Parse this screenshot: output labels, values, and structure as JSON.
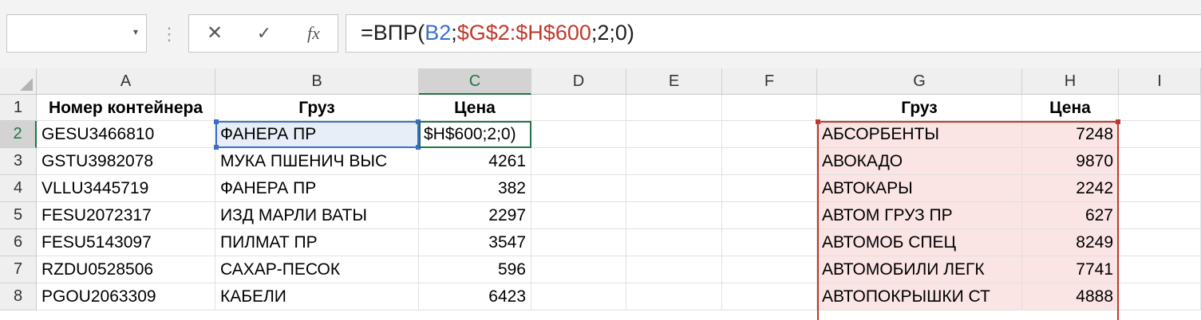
{
  "formula_bar": {
    "name_box_value": "",
    "cancel_icon": "x-mark",
    "enter_icon": "check-mark",
    "fx_label": "fx",
    "formula_parts": {
      "p1": "=ВПР(",
      "p2": "B2",
      "p3": ";",
      "p4": "$G$2:$H$600",
      "p5": ";2;0)"
    }
  },
  "columns": [
    "A",
    "B",
    "C",
    "D",
    "E",
    "F",
    "G",
    "H",
    "I"
  ],
  "rows": [
    "1",
    "2",
    "3",
    "4",
    "5",
    "6",
    "7",
    "8"
  ],
  "table1": {
    "headers": [
      "Номер контейнера",
      "Груз",
      "Цена"
    ],
    "rows": [
      [
        "GESU3466810",
        "ФАНЕРА ПР",
        "$H$600;2;0)"
      ],
      [
        "GSTU3982078",
        "МУКА ПШЕНИЧ ВЫС",
        "4261"
      ],
      [
        "VLLU3445719",
        "ФАНЕРА ПР",
        "382"
      ],
      [
        "FESU2072317",
        "ИЗД МАРЛИ ВАТЫ",
        "2297"
      ],
      [
        "FESU5143097",
        "ПИЛМАТ ПР",
        "3547"
      ],
      [
        "RZDU0528506",
        "САХАР-ПЕСОК",
        "596"
      ],
      [
        "PGOU2063309",
        "КАБЕЛИ",
        "6423"
      ]
    ]
  },
  "table2": {
    "headers": [
      "Груз",
      "Цена"
    ],
    "rows": [
      [
        "АБСОРБЕНТЫ",
        "7248"
      ],
      [
        "АВОКАДО",
        "9870"
      ],
      [
        "АВТОКАРЫ",
        "2242"
      ],
      [
        "АВТОМ ГРУЗ ПР",
        "627"
      ],
      [
        "АВТОМОБ СПЕЦ",
        "8249"
      ],
      [
        "АВТОМОБИЛИ ЛЕГК",
        "7741"
      ],
      [
        "АВТОПОКРЫШКИ СТ",
        "4888"
      ]
    ]
  },
  "colors": {
    "selection": "#217346",
    "ref_blue": "#3a6fc9",
    "ref_red": "#c0392b",
    "ref_fill": "#fbe4e4"
  }
}
